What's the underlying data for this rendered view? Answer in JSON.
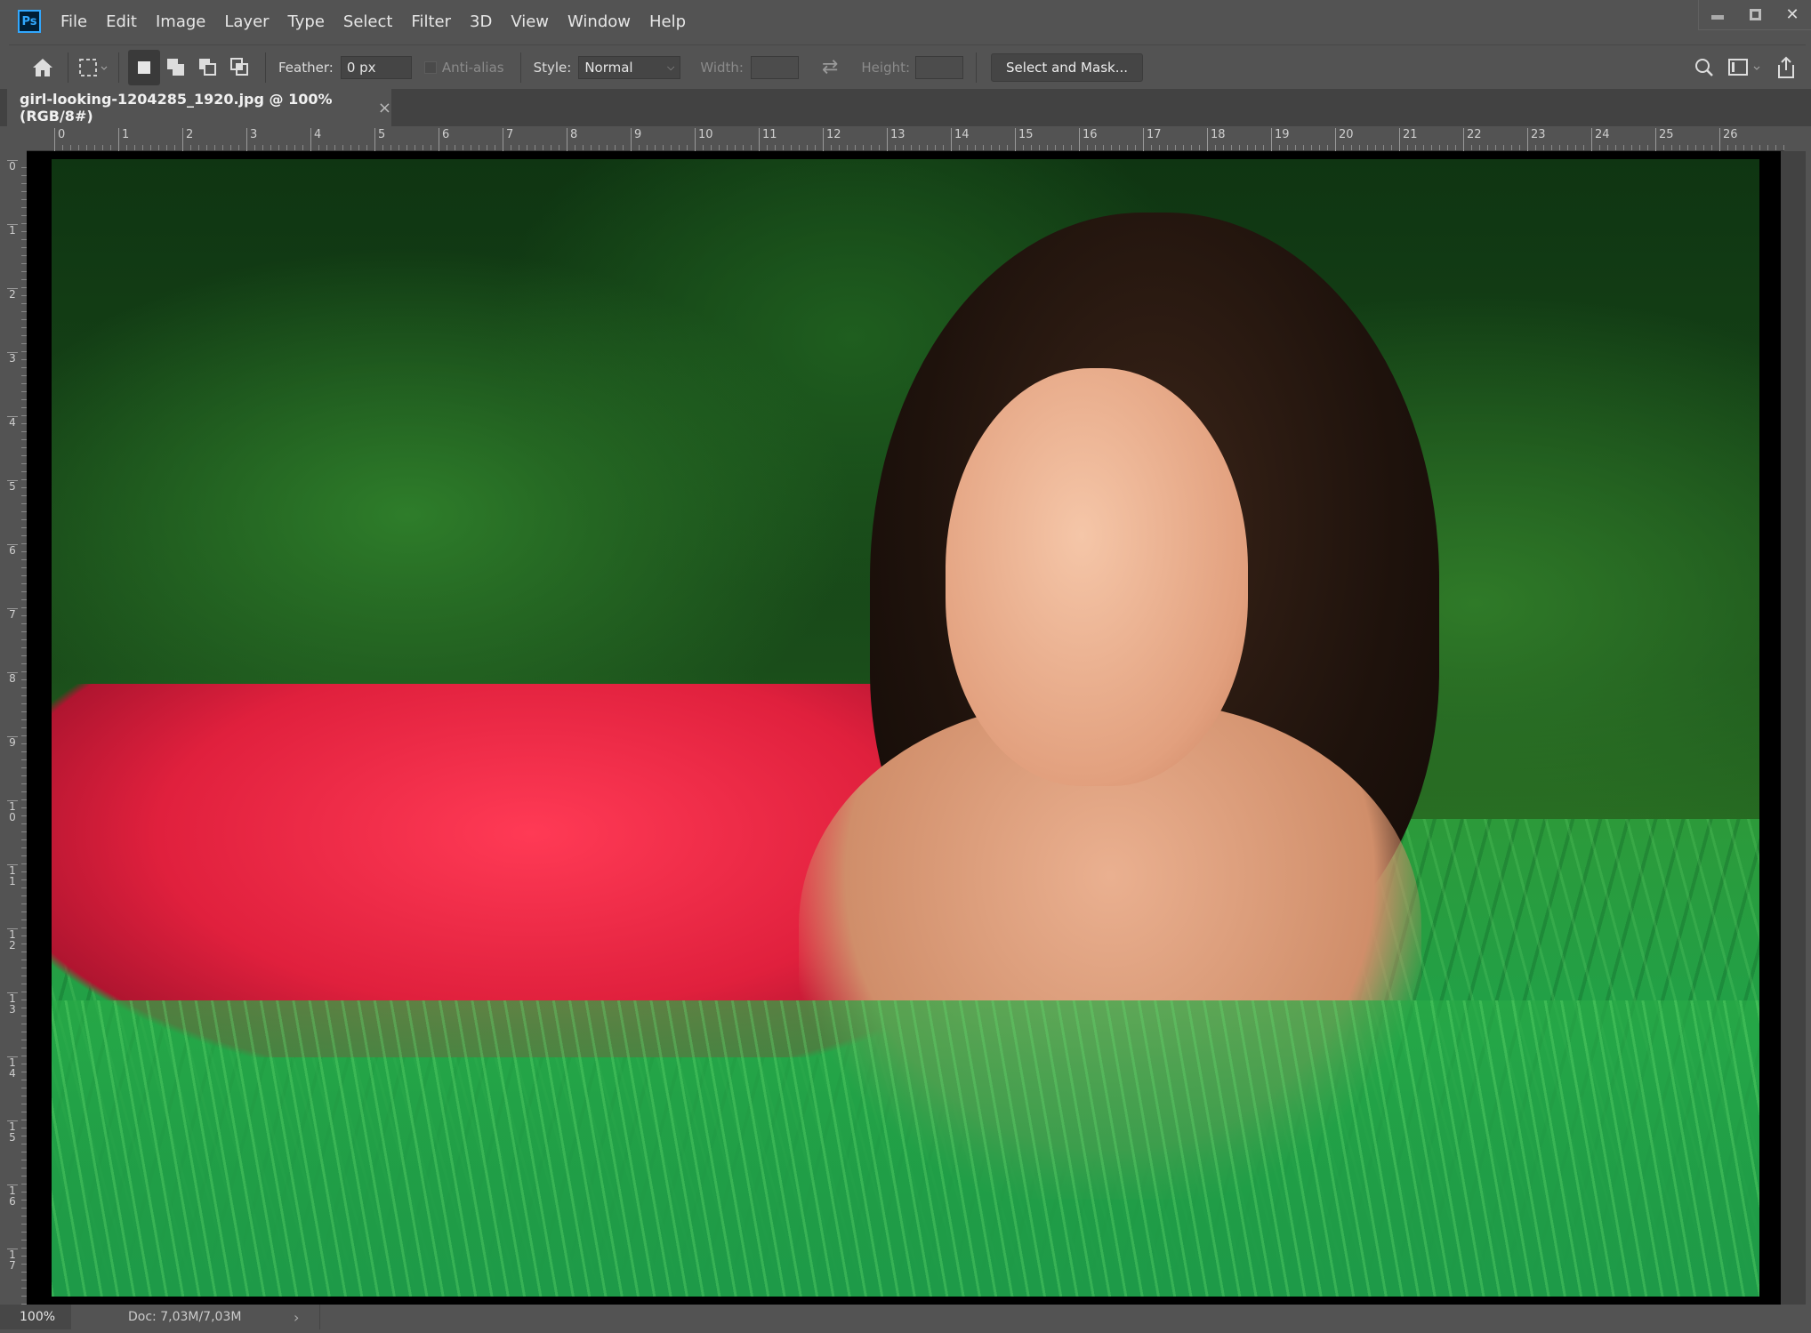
{
  "app": {
    "logo": "Ps",
    "accent": "#31a8ff"
  },
  "menu": [
    "File",
    "Edit",
    "Image",
    "Layer",
    "Type",
    "Select",
    "Filter",
    "3D",
    "View",
    "Window",
    "Help"
  ],
  "window_controls": {
    "minimize": "minimize-icon",
    "maximize": "maximize-icon",
    "close": "✕"
  },
  "toolbar": {
    "feather_label": "Feather:",
    "feather_value": "0 px",
    "antialias_label": "Anti-alias",
    "style_label": "Style:",
    "style_value": "Normal",
    "width_label": "Width:",
    "width_value": "",
    "height_label": "Height:",
    "height_value": "",
    "select_mask": "Select and Mask..."
  },
  "document": {
    "tab_title": "girl-looking-1204285_1920.jpg @ 100% (RGB/8#)",
    "close": "×"
  },
  "ruler": {
    "horizontal": [
      "0",
      "1",
      "2",
      "3",
      "4",
      "5",
      "6",
      "7",
      "8",
      "9",
      "10",
      "11",
      "12",
      "13",
      "14",
      "15",
      "16",
      "17",
      "18",
      "19",
      "20",
      "21",
      "22",
      "23",
      "24",
      "25",
      "26"
    ],
    "vertical": [
      "0",
      "1",
      "2",
      "3",
      "4",
      "5",
      "6",
      "7",
      "8",
      "9",
      "10",
      "11",
      "12",
      "13",
      "14",
      "15",
      "16",
      "17"
    ]
  },
  "status": {
    "zoom": "100%",
    "doc": "Doc: 7,03M/7,03M",
    "arrow": "›"
  }
}
